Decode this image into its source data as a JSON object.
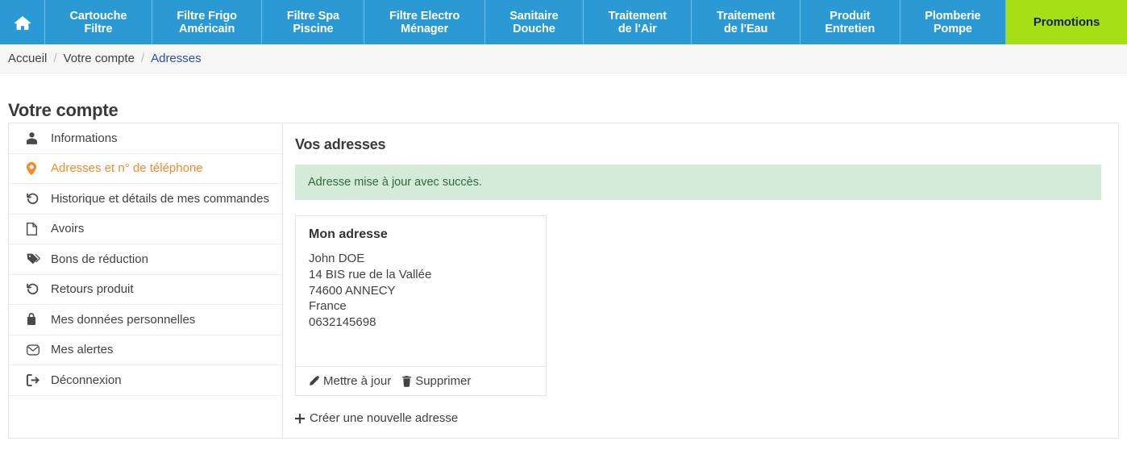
{
  "nav": {
    "home_icon": "home-icon",
    "items": [
      {
        "line1": "Cartouche",
        "line2": "Filtre"
      },
      {
        "line1": "Filtre Frigo",
        "line2": "Américain"
      },
      {
        "line1": "Filtre Spa",
        "line2": "Piscine"
      },
      {
        "line1": "Filtre Electro",
        "line2": "Ménager"
      },
      {
        "line1": "Sanitaire",
        "line2": "Douche"
      },
      {
        "line1": "Traitement",
        "line2": "de l'Air"
      },
      {
        "line1": "Traitement",
        "line2": "de l'Eau"
      },
      {
        "line1": "Produit",
        "line2": "Entretien"
      },
      {
        "line1": "Plomberie",
        "line2": "Pompe"
      }
    ],
    "promo_label": "Promotions",
    "bg_color": "#2b9ad4",
    "promo_color": "#a5e016",
    "promo_text_color": "#16214a"
  },
  "breadcrumb": {
    "home": "Accueil",
    "account": "Votre compte",
    "current": "Adresses",
    "separator": "/"
  },
  "page": {
    "title": "Votre compte"
  },
  "sidebar": {
    "items": [
      {
        "label": "Informations",
        "icon": "user-icon",
        "active": false
      },
      {
        "label": "Adresses et n° de téléphone",
        "icon": "map-pin-icon",
        "active": true
      },
      {
        "label": "Historique et détails de mes commandes",
        "icon": "history-icon",
        "active": false
      },
      {
        "label": "Avoirs",
        "icon": "file-icon",
        "active": false
      },
      {
        "label": "Bons de réduction",
        "icon": "tag-icon",
        "active": false
      },
      {
        "label": "Retours produit",
        "icon": "undo-icon",
        "active": false
      },
      {
        "label": "Mes données personnelles",
        "icon": "lock-icon",
        "active": false
      },
      {
        "label": "Mes alertes",
        "icon": "envelope-icon",
        "active": false
      },
      {
        "label": "Déconnexion",
        "icon": "sign-out-icon",
        "active": false
      }
    ],
    "active_color": "#f6892a"
  },
  "main": {
    "title": "Vos adresses",
    "alert": {
      "message": "Adresse mise à jour avec succès.",
      "bg_color": "#d5ebd9",
      "text_color": "#2d6a3d"
    },
    "address": {
      "alias": "Mon adresse",
      "line_name": "John DOE",
      "line_street": "14 BIS rue de la Vallée",
      "line_city": "74600 ANNECY",
      "line_country": "France",
      "line_phone": "0632145698",
      "update_label": "Mettre à jour",
      "delete_label": "Supprimer",
      "update_icon": "pencil-icon",
      "delete_icon": "trash-icon"
    },
    "create_label": "Créer une nouvelle adresse",
    "create_icon": "plus-icon"
  }
}
